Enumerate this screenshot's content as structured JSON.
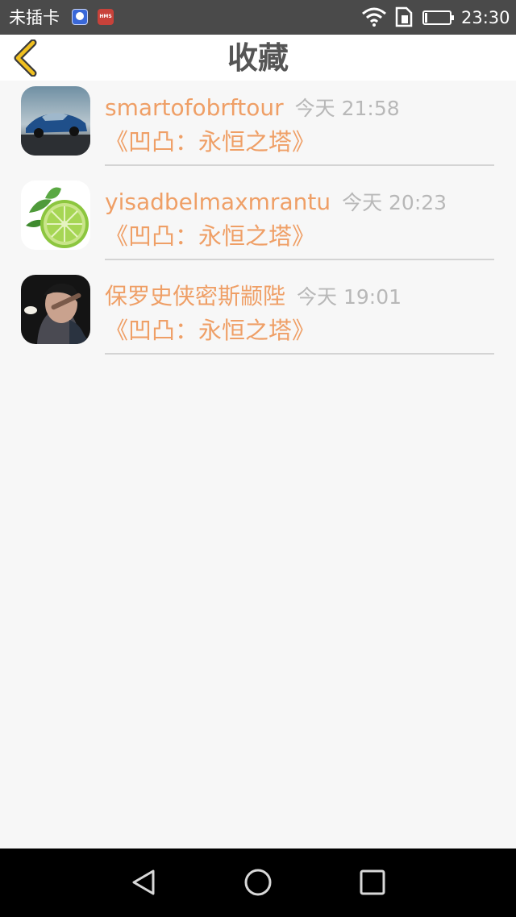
{
  "status_bar": {
    "carrier": "未插卡",
    "hms_label": "HMS",
    "time": "23:30"
  },
  "header": {
    "title": "收藏"
  },
  "items": [
    {
      "username": "smartofobrftour",
      "time": "今天 21:58",
      "book": "《凹凸：永恒之塔》"
    },
    {
      "username": "yisadbelmaxmrantu",
      "time": "今天 20:23",
      "book": "《凹凸：永恒之塔》"
    },
    {
      "username": "保罗史侠密斯颛陛",
      "time": "今天 19:01",
      "book": "《凹凸：永恒之塔》"
    }
  ],
  "colors": {
    "accent": "#ef9f66",
    "timestamp": "#b8b8b8",
    "title": "#555555",
    "background": "#f7f7f7",
    "back_chevron": "#f0c020"
  },
  "icons": {
    "back": "chevron-left-icon",
    "avatars": [
      "car-avatar",
      "lime-avatar",
      "portrait-avatar"
    ],
    "nav": [
      "triangle-back-icon",
      "circle-home-icon",
      "square-recent-icon"
    ]
  }
}
